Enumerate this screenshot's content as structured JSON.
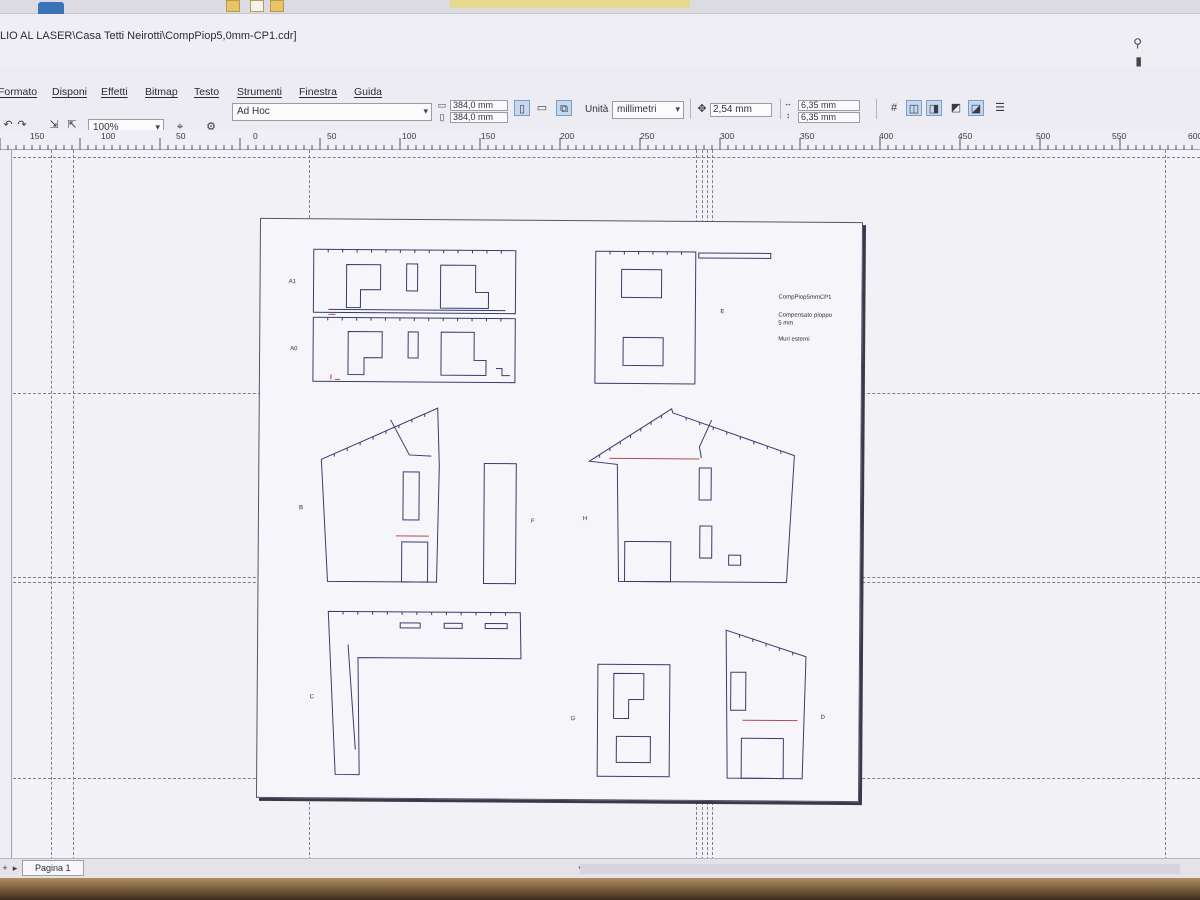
{
  "window": {
    "title": "LIO AL LASER\\Casa Tetti Neirotti\\CompPiop5,0mm-CP1.cdr]"
  },
  "menu": [
    {
      "label": "Formato"
    },
    {
      "label": "Disponi"
    },
    {
      "label": "Effetti"
    },
    {
      "label": "Bitmap"
    },
    {
      "label": "Testo"
    },
    {
      "label": "Strumenti"
    },
    {
      "label": "Finestra"
    },
    {
      "label": "Guida"
    }
  ],
  "toolbar": {
    "zoom_value": "100%",
    "page_size_preset": "Ad Hoc",
    "page_width": "384,0 mm",
    "page_height": "384,0 mm",
    "units_label": "Unità",
    "units_value": "millimetri",
    "nudge_value": "2,54 mm",
    "duplicate_x": "6,35 mm",
    "duplicate_y": "6,35 mm"
  },
  "ruler": {
    "h_ticks": [
      "150",
      "100",
      "50",
      "0",
      "50",
      "100",
      "150",
      "200",
      "250",
      "300",
      "350",
      "400",
      "450",
      "500",
      "550",
      "600"
    ]
  },
  "document": {
    "labels": {
      "a1": "A1",
      "a0": "A0",
      "e": "E",
      "b": "B",
      "f": "F",
      "h": "H",
      "c": "C",
      "g": "G",
      "d": "D"
    },
    "notes": {
      "line1": "CompPiop5mmCP1",
      "line2": "Compensato pioppo",
      "line3": "5 mm",
      "line4": "Muri esterni"
    }
  },
  "status": {
    "page_tab": "Pagina 1"
  },
  "colors": {
    "canvas": "#f2f1f6",
    "line": "#3b3a6e",
    "accent_red": "#b04a55"
  }
}
